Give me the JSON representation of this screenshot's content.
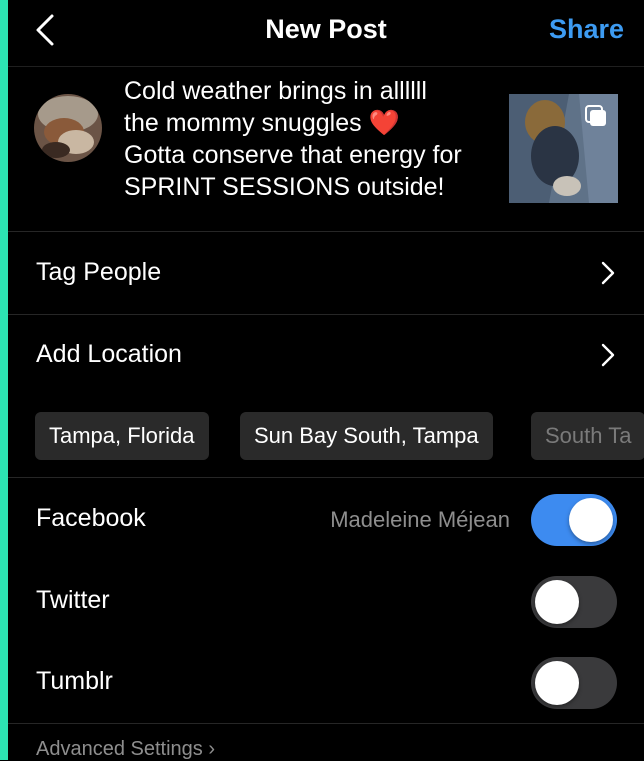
{
  "header": {
    "title": "New Post",
    "share_label": "Share",
    "back_icon": "chevron-left-icon",
    "accent_color": "#3d9bf2"
  },
  "post": {
    "caption": "Cold weather brings in allllll\nthe mommy snuggles ❤️\nGotta conserve that energy for\nSPRINT SESSIONS outside!",
    "multi_image_icon": "multiple-images-icon"
  },
  "rows": {
    "tag_people": "Tag People",
    "add_location": "Add Location"
  },
  "location_suggestions": [
    "Tampa, Florida",
    "Sun Bay South, Tampa",
    "South Ta"
  ],
  "sharing": {
    "facebook": {
      "label": "Facebook",
      "account": "Madeleine Méjean",
      "enabled": true
    },
    "twitter": {
      "label": "Twitter",
      "enabled": false
    },
    "tumblr": {
      "label": "Tumblr",
      "enabled": false
    },
    "toggle_on_color": "#3d8bf0"
  },
  "advanced_settings": "Advanced Settings ›"
}
